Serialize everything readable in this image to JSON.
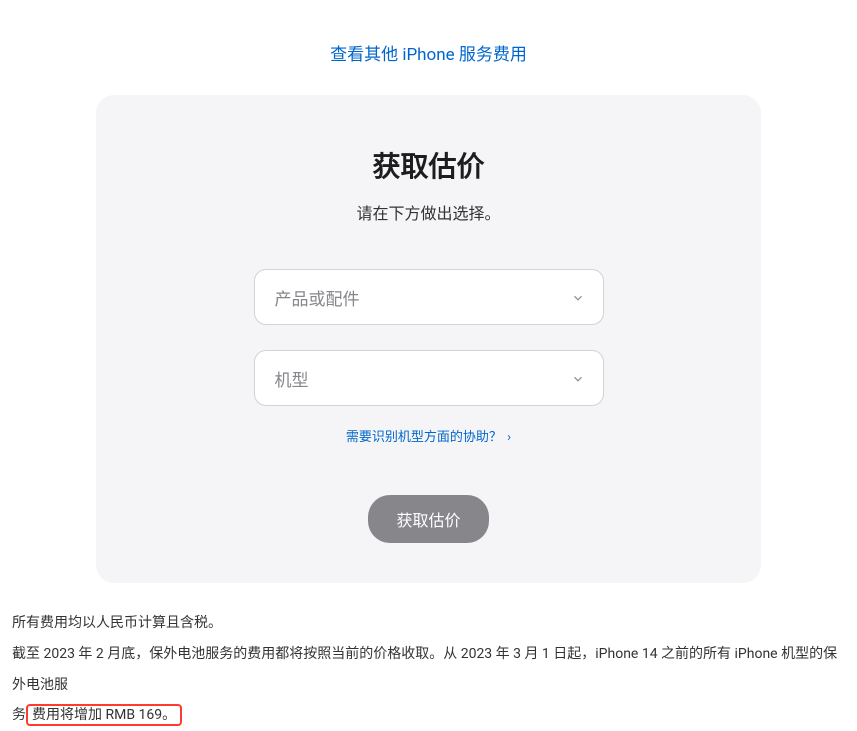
{
  "topLink": {
    "label": "查看其他 iPhone 服务费用"
  },
  "card": {
    "title": "获取估价",
    "subtitle": "请在下方做出选择。",
    "select1": {
      "placeholder": "产品或配件"
    },
    "select2": {
      "placeholder": "机型"
    },
    "helpLink": "需要识别机型方面的协助？",
    "helpArrow": "›",
    "submit": "获取估价"
  },
  "disclaimer": {
    "line1": "所有费用均以人民币计算且含税。",
    "line2_a": "截至 2023 年 2 月底，保外电池服务的费用都将按照当前的价格收取。从 2023 年 3 月 1 日起，iPhone 14 之前的所有 iPhone 机型的保外电池服",
    "line2_b_prefix": "务",
    "line2_highlight": "费用将增加 RMB 169。"
  }
}
